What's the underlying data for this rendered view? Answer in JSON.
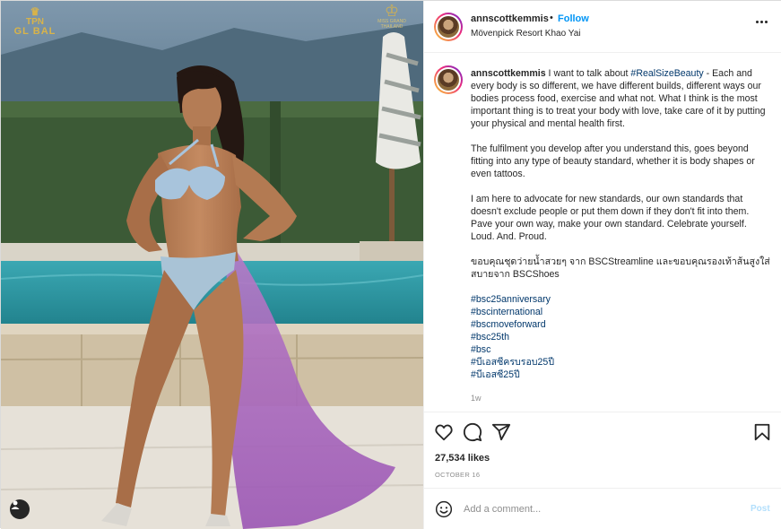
{
  "photo": {
    "watermark_left_line1": "TPN",
    "watermark_left_line2": "GL BAL",
    "watermark_right_small": "MISS GRAND THAILAND",
    "user_tag_icon": "user-icon"
  },
  "header": {
    "username": "annscottkemmis",
    "separator": "•",
    "follow_label": "Follow",
    "location": "Mövenpick Resort Khao Yai",
    "more_icon": "more-options-icon"
  },
  "caption": {
    "username": "annscottkemmis",
    "p1_start": " I want to talk about ",
    "p1_hashtag": "#RealSizeBeauty",
    "p1_end": " - Each and every body is so different, we have different builds, different ways our bodies process food, exercise and what not. What I think is the most important thing is to treat your body with love, take care of it by putting your physical and mental health first.",
    "p2": "The fulfilment you develop after you understand this, goes beyond fitting into any type of beauty standard, whether it is body shapes or even tattoos.",
    "p3": "I am here to advocate for new standards, our own standards that doesn't exclude people or put them down if they don't fit into them. Pave your own way, make your own standard. Celebrate yourself. Loud. And. Proud.",
    "p4": "ขอบคุณชุดว่ายน้ำสวยๆ จาก BSCStreamline และขอบคุณรองเท้าส้นสูงใส่สบายจาก BSCShoes",
    "hashtags": [
      "#bsc25anniversary",
      "#bscinternational",
      "#bscmoveforward",
      "#bsc25th",
      "#bsc",
      "#บีเอสซีครบรอบ25ปี",
      "#บีเอสซี25ปี"
    ],
    "time_ago": "1w"
  },
  "actions": {
    "icons": [
      "heart-icon",
      "comment-icon",
      "share-icon",
      "bookmark-icon"
    ],
    "likes": "27,534 likes",
    "date": "OCTOBER 16"
  },
  "comment": {
    "placeholder": "Add a comment...",
    "post_label": "Post",
    "emoji_icon": "emoji-icon"
  },
  "colors": {
    "link_blue": "#0095f6",
    "hashtag_blue": "#00376b",
    "muted_gray": "#8e8e8e",
    "post_disabled": "#b2dffc"
  }
}
